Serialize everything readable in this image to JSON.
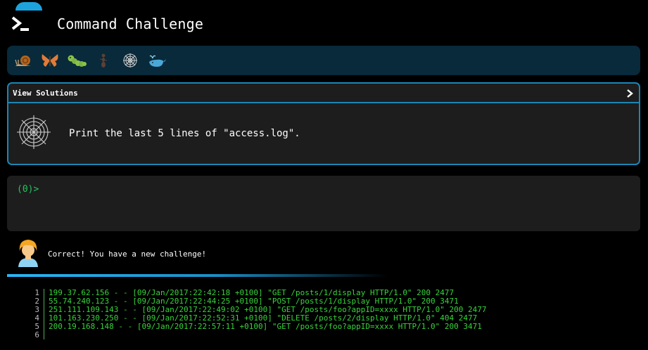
{
  "header": {
    "title": "Command Challenge",
    "logo_icon": "terminal-icon"
  },
  "levels": [
    {
      "icon": "snail-icon",
      "glyph": "🐌"
    },
    {
      "icon": "butterfly-icon",
      "glyph": "🦋"
    },
    {
      "icon": "caterpillar-icon",
      "glyph": "🐛"
    },
    {
      "icon": "ant-icon",
      "glyph": "🐜"
    },
    {
      "icon": "spiderweb-icon",
      "glyph": "🕸"
    },
    {
      "icon": "whale-icon",
      "glyph": "🐳"
    }
  ],
  "challenge": {
    "view_solutions_label": "View Solutions",
    "icon": "spiderweb-icon",
    "prompt": "Print the last 5 lines of \"access.log\"."
  },
  "terminal": {
    "prompt": "(0)>",
    "value": ""
  },
  "feedback": {
    "avatar_icon": "person-icon",
    "message": "Correct! You have a new challenge!"
  },
  "output": {
    "lines": [
      {
        "n": "1",
        "text": "199.37.62.156 - - [09/Jan/2017:22:42:18 +0100] \"GET /posts/1/display HTTP/1.0\" 200 2477"
      },
      {
        "n": "2",
        "text": "55.74.240.123 - - [09/Jan/2017:22:44:25 +0100] \"POST /posts/1/display HTTP/1.0\" 200 3471"
      },
      {
        "n": "3",
        "text": "251.111.109.143 - - [09/Jan/2017:22:49:02 +0100] \"GET /posts/foo?appID=xxxx HTTP/1.0\" 200 2477"
      },
      {
        "n": "4",
        "text": "101.163.230.250 - - [09/Jan/2017:22:52:31 +0100] \"DELETE /posts/2/display HTTP/1.0\" 404 2477"
      },
      {
        "n": "5",
        "text": "200.19.168.148 - - [09/Jan/2017:22:57:11 +0100] \"GET /posts/foo?appID=xxxx HTTP/1.0\" 200 3471"
      },
      {
        "n": "6",
        "text": ""
      }
    ]
  },
  "colors": {
    "accent": "#1b86b4",
    "background": "#000000",
    "panel": "#1d1d1d",
    "output_text": "#37d43a"
  }
}
